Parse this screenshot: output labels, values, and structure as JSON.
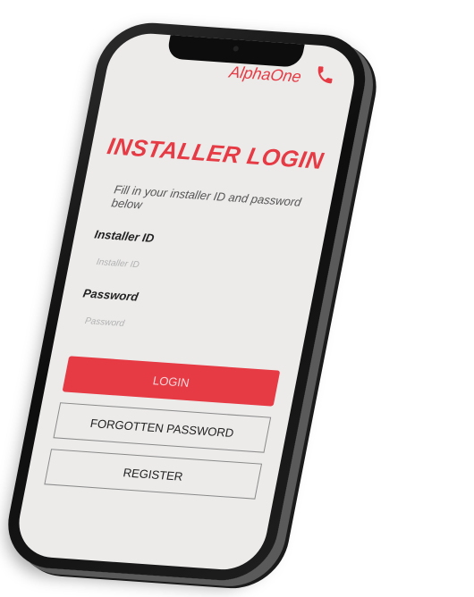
{
  "header": {
    "brand": "AlphaOne",
    "call_icon": "phone-handset-icon"
  },
  "login": {
    "title": "INSTALLER LOGIN",
    "intro": "Fill in your installer ID and password below",
    "installer_id_label": "Installer ID",
    "installer_id_placeholder": "Installer ID",
    "password_label": "Password",
    "password_placeholder": "Password",
    "login_button": "LOGIN",
    "forgot_button": "FORGOTTEN PASSWORD",
    "register_button": "REGISTER"
  },
  "colors": {
    "accent": "#e63a44",
    "screen_background": "#ecebea",
    "device_frame": "#111111"
  }
}
